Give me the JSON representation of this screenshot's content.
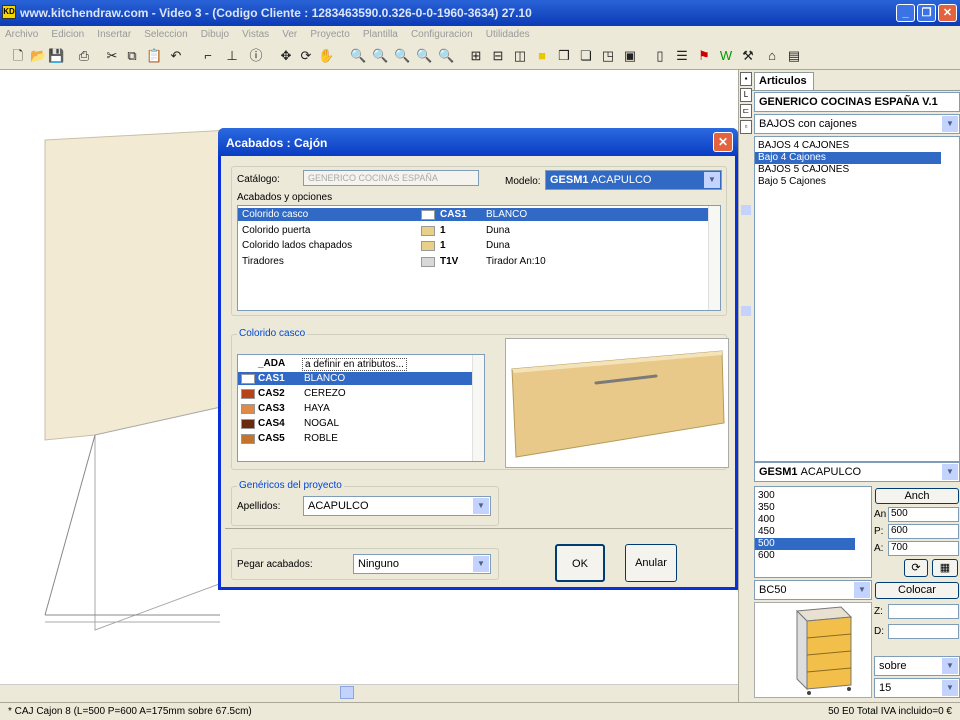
{
  "window": {
    "title": "www.kitchendraw.com - Video 3 - (Codigo Cliente : 1283463590.0.326-0-0-1960-3634) 27.10"
  },
  "menu": [
    "Archivo",
    "Edicion",
    "Insertar",
    "Seleccion",
    "Dibujo",
    "Vistas",
    "Ver",
    "Proyecto",
    "Plantilla",
    "Configuracion",
    "Utilidades"
  ],
  "statusbar": {
    "left": "* CAJ  Cajon 8 (L=500 P=600 A=175mm sobre 67.5cm)",
    "right": "50  E0 Total IVA incluido=0 €"
  },
  "panel": {
    "tab": "Articulos",
    "catalog": "GENERICO COCINAS ESPAÑA V.1",
    "family": "BAJOS con cajones",
    "items": [
      "BAJOS 4 CAJONES",
      "Bajo 4 Cajones",
      "BAJOS 5 CAJONES",
      "Bajo 5 Cajones"
    ],
    "model_code": "GESM1",
    "model_name": "ACAPULCO",
    "widths": [
      "300",
      "350",
      "400",
      "450",
      "500",
      "600"
    ],
    "anch_button": "Anch",
    "an_label": "An",
    "an_value": "500",
    "p_label": "P:",
    "p_value": "600",
    "a_label": "A:",
    "a_value": "700",
    "ref": "BC50",
    "colocar_button": "Colocar",
    "z_label": "Z:",
    "d_label": "D:",
    "position": "sobre",
    "level": "15"
  },
  "dialog": {
    "title": "Acabados : Cajón",
    "catalog_label": "Catálogo:",
    "catalog_value": "GENERICO COCINAS ESPAÑA",
    "model_label": "Modelo:",
    "model_code": "GESM1",
    "model_name": "ACAPULCO",
    "options_label": "Acabados y opciones",
    "options": [
      {
        "name": "Colorido casco",
        "code": "CAS1",
        "value": "BLANCO",
        "color": "#ffffff"
      },
      {
        "name": "Colorido puerta",
        "code": "1",
        "value": "Duna",
        "color": "#e8d08a"
      },
      {
        "name": "Colorido lados chapados",
        "code": "1",
        "value": "Duna",
        "color": "#e8d08a"
      },
      {
        "name": "Tiradores",
        "code": "T1V",
        "value": "Tirador An:10",
        "color": "#d8d8d8"
      }
    ],
    "finish_group": "Colorido casco",
    "finishes": [
      {
        "code": "_ADA",
        "name": "a definir en atributos...",
        "color": ""
      },
      {
        "code": "CAS1",
        "name": "BLANCO",
        "color": "#ffffff"
      },
      {
        "code": "CAS2",
        "name": "CEREZO",
        "color": "#b8431b"
      },
      {
        "code": "CAS3",
        "name": "HAYA",
        "color": "#e08a4a"
      },
      {
        "code": "CAS4",
        "name": "NOGAL",
        "color": "#6a2a12"
      },
      {
        "code": "CAS5",
        "name": "ROBLE",
        "color": "#c4742a"
      }
    ],
    "generics_group": "Genéricos del proyecto",
    "apellidos_label": "Apellidos:",
    "apellidos_value": "ACAPULCO",
    "paste_label": "Pegar acabados:",
    "paste_value": "Ninguno",
    "ok": "OK",
    "cancel": "Anular"
  },
  "colors": {
    "selection": "#316ac5",
    "titlebar": "#0a3cc3",
    "drawer_front": "#e8c98a"
  }
}
